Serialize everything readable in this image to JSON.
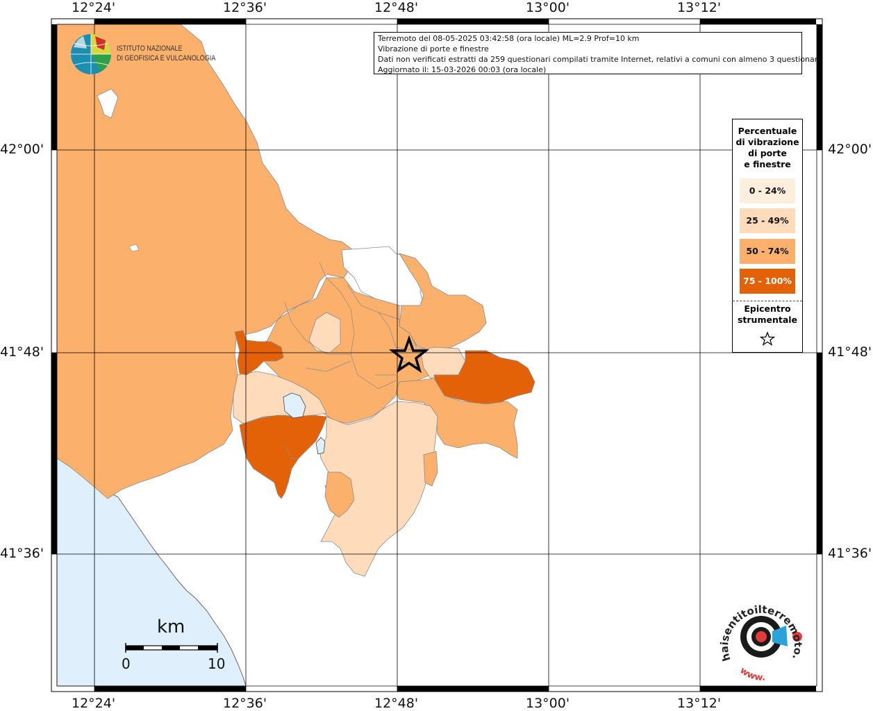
{
  "header": {
    "line1": "Terremoto del 08-05-2025 03:42:58 (ora locale) ML=2.9 Prof=10 km",
    "line2": "Vibrazione di porte e finestre",
    "line3": "Dati non verificati estratti da 259 questionari compilati tramite Internet, relativi a comuni con almeno 3 questionari.",
    "line4": "Aggiornato il: 15-03-2026 00:03 (ora locale)"
  },
  "logo": {
    "line1": "ISTITUTO NAZIONALE",
    "line2": "DI GEOFISICA E VULCANOLOGIA"
  },
  "axes": {
    "top": [
      "12°24'",
      "12°36'",
      "12°48'",
      "13°00'",
      "13°12'"
    ],
    "bottom": [
      "12°24'",
      "12°36'",
      "12°48'",
      "13°00'",
      "13°12'"
    ],
    "left": [
      "42°00'",
      "41°48'",
      "41°36'"
    ],
    "right": [
      "42°00'",
      "41°48'",
      "41°36'"
    ]
  },
  "legend": {
    "title_lines": [
      "Percentuale",
      "di vibrazione",
      "di porte",
      "e finestre"
    ],
    "classes": [
      {
        "label": "0 - 24%",
        "color": "#fdeedd"
      },
      {
        "label": "25 - 49%",
        "color": "#fddbbb"
      },
      {
        "label": "50 - 74%",
        "color": "#fbb06b"
      },
      {
        "label": "75 - 100%",
        "color": "#e36207"
      }
    ],
    "epicenter_line1": "Epicentro",
    "epicenter_line2": "strumentale"
  },
  "scale_bar": {
    "unit": "km",
    "min": "0",
    "max": "10"
  },
  "site_logo": {
    "text": "haisentitoilterremoto.it",
    "prefix": "www."
  },
  "colors": {
    "sea": "#dff0fc",
    "lake": "#dff0fc",
    "border": "#8a8a8a"
  }
}
